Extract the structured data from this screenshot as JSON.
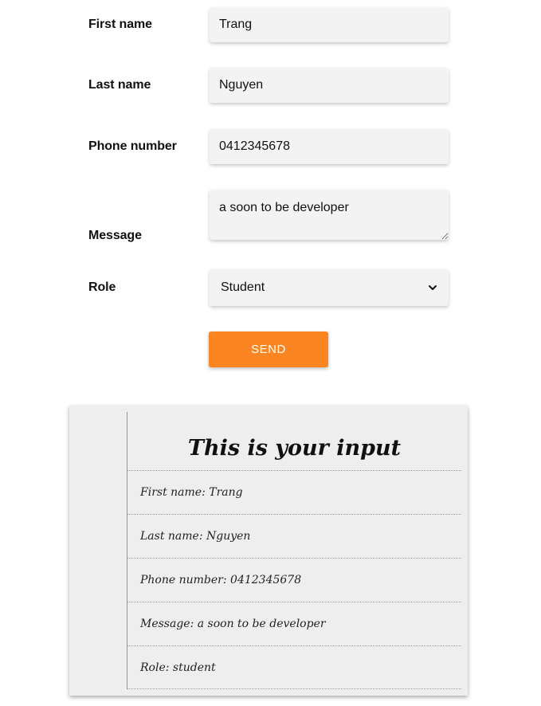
{
  "form": {
    "first_name": {
      "label": "First name",
      "value": "Trang"
    },
    "last_name": {
      "label": "Last name",
      "value": "Nguyen"
    },
    "phone": {
      "label": "Phone number",
      "value": "0412345678"
    },
    "message": {
      "label": "Message",
      "value": "a soon to be developer"
    },
    "role": {
      "label": "Role",
      "selected": "Student"
    },
    "send_label": "SEND"
  },
  "output": {
    "title": "This is your input",
    "rows": [
      "First name: Trang",
      "Last name: Nguyen",
      "Phone number: 0412345678",
      "Message: a soon to be developer",
      "Role: student"
    ]
  },
  "colors": {
    "accent": "#fb8520",
    "field_bg": "#f3f3f3",
    "card_bg": "#eeeeee",
    "margin_line": "#e57373"
  },
  "icons": {
    "select_arrow": "chevron-down-icon"
  }
}
